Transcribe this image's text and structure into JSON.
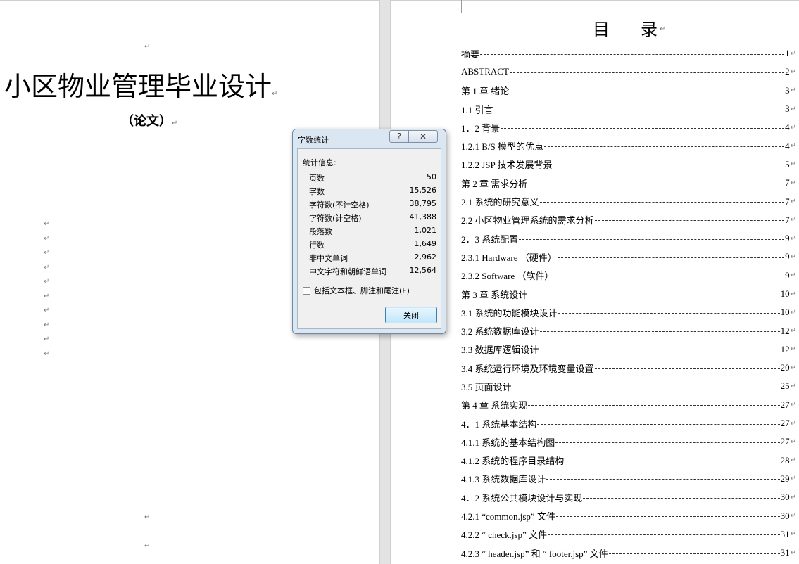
{
  "left_page": {
    "title": "小区物业管理毕业设计",
    "subtitle": "（论文）",
    "paragraph_mark": "↵"
  },
  "right_page": {
    "toc_heading": "目录",
    "toc_items": [
      {
        "label": "摘要",
        "page": "1"
      },
      {
        "label": "ABSTRACT",
        "page": "2"
      },
      {
        "label": "第 1 章 绪论",
        "page": "3"
      },
      {
        "label": "1.1 引言",
        "page": "3"
      },
      {
        "label": "1．2  背景",
        "page": "4"
      },
      {
        "label": "1.2.1 B/S 模型的优点",
        "page": "4"
      },
      {
        "label": "1.2.2 JSP 技术发展背景",
        "page": "5"
      },
      {
        "label": "第 2 章  需求分析",
        "page": "7"
      },
      {
        "label": "2.1  系统的研究意义",
        "page": "7"
      },
      {
        "label": "2.2  小区物业管理系统的需求分析",
        "page": "7"
      },
      {
        "label": "2．3  系统配置",
        "page": "9"
      },
      {
        "label": "2.3.1    Hardware （硬件）",
        "page": "9"
      },
      {
        "label": "2.3.2 Software （软件）",
        "page": "9"
      },
      {
        "label": "第 3 章  系统设计",
        "page": "10"
      },
      {
        "label": "3.1  系统的功能模块设计",
        "page": "10"
      },
      {
        "label": "3.2  系统数据库设计",
        "page": "12"
      },
      {
        "label": "3.3  数据库逻辑设计",
        "page": "12"
      },
      {
        "label": "3.4  系统运行环境及环境变量设置",
        "page": "20"
      },
      {
        "label": "3.5  页面设计",
        "page": "25"
      },
      {
        "label": "第 4 章  系统实现",
        "page": "27"
      },
      {
        "label": "4．1 系统基本结构",
        "page": "27"
      },
      {
        "label": "4.1.1  系统的基本结构图",
        "page": "27"
      },
      {
        "label": "4.1.2  系统的程序目录结构",
        "page": "28"
      },
      {
        "label": "4.1.3  系统数据库设计",
        "page": "29"
      },
      {
        "label": "4．2  系统公共模块设计与实现",
        "page": "30"
      },
      {
        "label": "4.2.1  “common.jsp” 文件",
        "page": "30"
      },
      {
        "label": "4.2.2  “ check.jsp” 文件",
        "page": "31"
      },
      {
        "label": "4.2.3  “ header.jsp” 和 “ footer.jsp” 文件",
        "page": "31"
      }
    ]
  },
  "dialog": {
    "title": "字数统计",
    "help_label": "?",
    "close_glyph": "✕",
    "stats_header": "统计信息:",
    "stats": [
      {
        "label": "页数",
        "value": "50"
      },
      {
        "label": "字数",
        "value": "15,526"
      },
      {
        "label": "字符数(不计空格)",
        "value": "38,795"
      },
      {
        "label": "字符数(计空格)",
        "value": "41,388"
      },
      {
        "label": "段落数",
        "value": "1,021"
      },
      {
        "label": "行数",
        "value": "1,649"
      },
      {
        "label": "非中文单词",
        "value": "2,962"
      },
      {
        "label": "中文字符和朝鲜语单词",
        "value": "12,564"
      }
    ],
    "checkbox_label": "包括文本框、脚注和尾注(F)",
    "checkbox_checked": false,
    "close_button_label": "关闭"
  }
}
